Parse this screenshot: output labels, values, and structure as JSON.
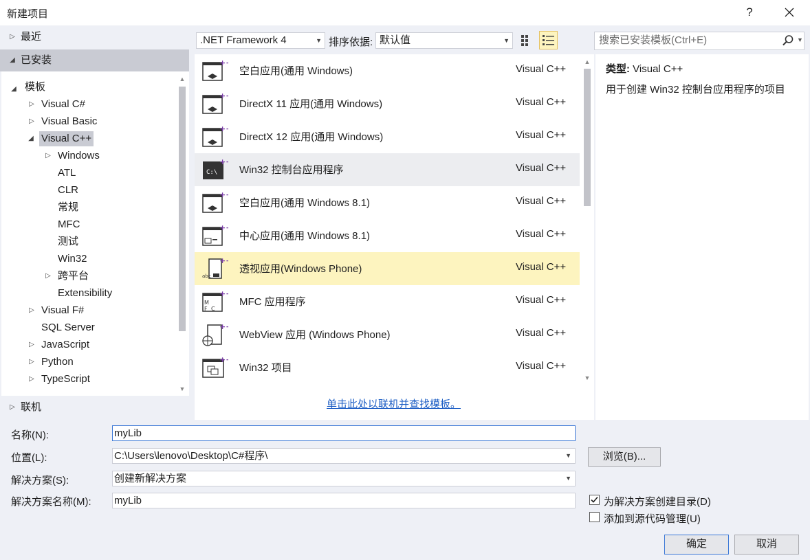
{
  "window": {
    "title": "新建项目",
    "help_label": "?",
    "close_icon": "close-icon"
  },
  "left_panel": {
    "recent": "最近",
    "installed": "已安装",
    "online": "联机",
    "tree": [
      {
        "label": "模板",
        "expanded": true
      },
      {
        "label": "Visual C#",
        "expanded": false
      },
      {
        "label": "Visual Basic",
        "expanded": false
      },
      {
        "label": "Visual C++",
        "expanded": true,
        "selected": true
      },
      {
        "label": "Windows",
        "expanded": false
      },
      {
        "label": "ATL"
      },
      {
        "label": "CLR"
      },
      {
        "label": "常规"
      },
      {
        "label": "MFC"
      },
      {
        "label": "测试"
      },
      {
        "label": "Win32"
      },
      {
        "label": "跨平台",
        "expanded": false
      },
      {
        "label": "Extensibility"
      },
      {
        "label": "Visual F#",
        "expanded": false
      },
      {
        "label": "SQL Server"
      },
      {
        "label": "JavaScript",
        "expanded": false
      },
      {
        "label": "Python",
        "expanded": false
      },
      {
        "label": "TypeScript",
        "expanded": false
      }
    ]
  },
  "toolbar": {
    "framework": ".NET Framework 4",
    "sort_label": "排序依据:",
    "sort_value": "默认值",
    "search_placeholder": "搜索已安装模板(Ctrl+E)"
  },
  "templates": [
    {
      "name": "空白应用(通用 Windows)",
      "lang": "Visual C++",
      "icon": "blank-app-icon"
    },
    {
      "name": "DirectX 11 应用(通用 Windows)",
      "lang": "Visual C++",
      "icon": "directx-app-icon"
    },
    {
      "name": "DirectX 12 应用(通用 Windows)",
      "lang": "Visual C++",
      "icon": "directx-app-icon"
    },
    {
      "name": "Win32 控制台应用程序",
      "lang": "Visual C++",
      "icon": "console-app-icon",
      "state": "hover"
    },
    {
      "name": "空白应用(通用 Windows 8.1)",
      "lang": "Visual C++",
      "icon": "blank-app-icon"
    },
    {
      "name": "中心应用(通用 Windows 8.1)",
      "lang": "Visual C++",
      "icon": "hub-app-icon"
    },
    {
      "name": "透视应用(Windows Phone)",
      "lang": "Visual C++",
      "icon": "pivot-app-icon",
      "state": "selected"
    },
    {
      "name": "MFC 应用程序",
      "lang": "Visual C++",
      "icon": "mfc-app-icon"
    },
    {
      "name": "WebView 应用 (Windows Phone)",
      "lang": "Visual C++",
      "icon": "webview-app-icon"
    },
    {
      "name": "Win32 项目",
      "lang": "Visual C++",
      "icon": "win32-project-icon"
    }
  ],
  "online_link": "单击此处以联机并查找模板。",
  "description": {
    "type_label": "类型:",
    "type_value": "Visual C++",
    "text": "用于创建 Win32 控制台应用程序的项目"
  },
  "form": {
    "name_label": "名称(N):",
    "name_value": "myLib",
    "location_label": "位置(L):",
    "location_value": "C:\\Users\\lenovo\\Desktop\\C#程序\\",
    "solution_label": "解决方案(S):",
    "solution_value": "创建新解决方案",
    "solution_name_label": "解决方案名称(M):",
    "solution_name_value": "myLib",
    "browse_label": "浏览(B)...",
    "create_dir_label": "为解决方案创建目录(D)",
    "create_dir_checked": true,
    "source_control_label": "添加到源代码管理(U)",
    "source_control_checked": false,
    "ok_label": "确定",
    "cancel_label": "取消"
  },
  "colors": {
    "dialog_bg": "#eef0f6",
    "selected_row": "#fdf4bf",
    "hover_row": "#ecedf0",
    "tree_selected": "#c9cbd3",
    "link": "#1e5fc5",
    "focus_border": "#3b78d6"
  }
}
